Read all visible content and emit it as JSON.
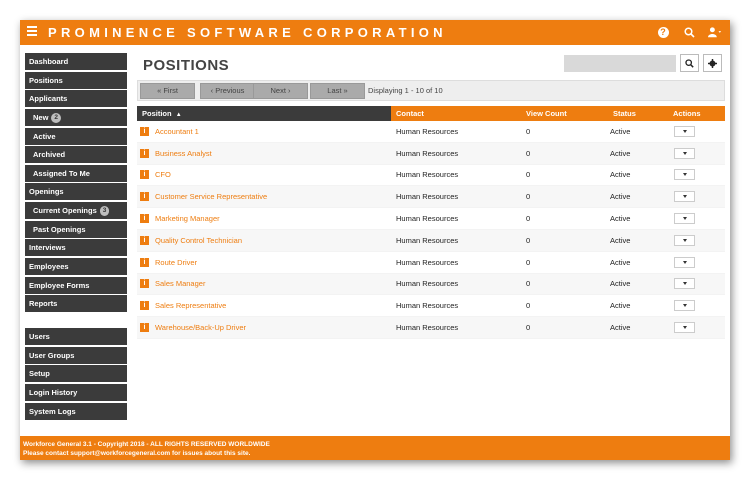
{
  "header": {
    "brand": "PROMINENCE SOFTWARE CORPORATION",
    "menu_icon": "hamburger-icon",
    "icons": [
      "help-icon",
      "search-icon",
      "user-icon"
    ]
  },
  "sidebar": {
    "primary": [
      {
        "label": "Dashboard",
        "sub": false
      },
      {
        "label": "Positions",
        "sub": false
      },
      {
        "label": "Applicants",
        "sub": false
      },
      {
        "label": "New",
        "sub": true,
        "badge": "2"
      },
      {
        "label": "Active",
        "sub": true
      },
      {
        "label": "Archived",
        "sub": true
      },
      {
        "label": "Assigned To Me",
        "sub": true
      },
      {
        "label": "Openings",
        "sub": false
      },
      {
        "label": "Current Openings",
        "sub": true,
        "badge": "3"
      },
      {
        "label": "Past Openings",
        "sub": true
      },
      {
        "label": "Interviews",
        "sub": false
      },
      {
        "label": "Employees",
        "sub": false
      },
      {
        "label": "Employee Forms",
        "sub": false
      },
      {
        "label": "Reports",
        "sub": false
      }
    ],
    "secondary": [
      {
        "label": "Users"
      },
      {
        "label": "User Groups"
      },
      {
        "label": "Setup"
      },
      {
        "label": "Login History"
      },
      {
        "label": "System Logs"
      }
    ]
  },
  "page": {
    "title": "POSITIONS",
    "search_placeholder": ""
  },
  "pager": {
    "first": "« First",
    "previous": "‹ Previous",
    "next": "Next ›",
    "last": "Last »",
    "status": "Displaying 1 - 10 of 10"
  },
  "table": {
    "headers": {
      "position": "Position",
      "sort_indicator": "▲",
      "contact": "Contact",
      "view_count": "View Count",
      "status": "Status",
      "actions": "Actions"
    },
    "rows": [
      {
        "position": "Accountant 1",
        "contact": "Human Resources",
        "views": "0",
        "status": "Active"
      },
      {
        "position": "Business Analyst",
        "contact": "Human Resources",
        "views": "0",
        "status": "Active"
      },
      {
        "position": "CFO",
        "contact": "Human Resources",
        "views": "0",
        "status": "Active"
      },
      {
        "position": "Customer Service Representative",
        "contact": "Human Resources",
        "views": "0",
        "status": "Active"
      },
      {
        "position": "Marketing Manager",
        "contact": "Human Resources",
        "views": "0",
        "status": "Active"
      },
      {
        "position": "Quality Control Technician",
        "contact": "Human Resources",
        "views": "0",
        "status": "Active"
      },
      {
        "position": "Route Driver",
        "contact": "Human Resources",
        "views": "0",
        "status": "Active"
      },
      {
        "position": "Sales Manager",
        "contact": "Human Resources",
        "views": "0",
        "status": "Active"
      },
      {
        "position": "Sales Representative",
        "contact": "Human Resources",
        "views": "0",
        "status": "Active"
      },
      {
        "position": "Warehouse/Back-Up Driver",
        "contact": "Human Resources",
        "views": "0",
        "status": "Active"
      }
    ]
  },
  "footer": {
    "line1": "Workforce General 3.1 - Copyright 2018 - ALL RIGHTS RESERVED WORLDWIDE",
    "line2": "Please contact support@workforcegeneral.com for issues about this site."
  },
  "colors": {
    "accent": "#ee7d10",
    "sidebar": "#3b3b3b"
  }
}
